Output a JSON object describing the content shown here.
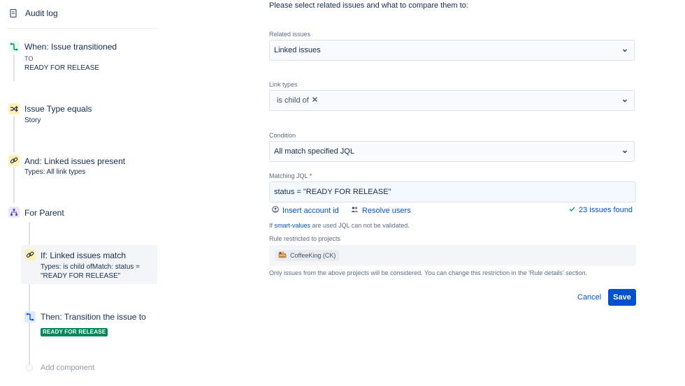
{
  "sidebar": {
    "audit_log": "Audit log",
    "steps": {
      "trigger": {
        "title": "When: Issue transitioned",
        "to_label": "TO",
        "status": "READY FOR RELEASE"
      },
      "issue_type": {
        "title": "Issue Type equals",
        "subtitle": "Story"
      },
      "linked_present": {
        "title": "And: Linked issues present",
        "subtitle": "Types: All link types"
      },
      "for_parent": {
        "title": "For Parent"
      },
      "linked_match": {
        "title": "If: Linked issues match",
        "subtitle_line1": "Types: is child ofMatch: status =",
        "subtitle_line2": "\"READY FOR RELEASE\""
      },
      "transition": {
        "title": "Then: Transition the issue to",
        "lozenge": "READY FOR RELEASE"
      },
      "add_component": "Add component"
    }
  },
  "form": {
    "intro": "Please select related issues and what to compare them to:",
    "related_issues": {
      "label": "Related issues",
      "value": "Linked issues"
    },
    "link_types": {
      "label": "Link types",
      "chip": "is child of"
    },
    "condition": {
      "label": "Condition",
      "value": "All match specified JQL"
    },
    "matching_jql": {
      "label": "Matching JQL",
      "required": "*",
      "value": "status = \"READY FOR RELEASE\""
    },
    "insert_account_id": "Insert account id",
    "resolve_users": "Resolve users",
    "issues_found": "23 issues found",
    "hint_prefix": "If ",
    "hint_link": "smart-values",
    "hint_suffix": " are used JQL can not be validated.",
    "rule_restricted": {
      "label": "Rule restricted to projects",
      "project": "CoffeeKing (CK)"
    },
    "restriction_note": "Only issues from the above projects will be considered. You can change this restriction in the 'Rule details' section.",
    "cancel": "Cancel",
    "save": "Save"
  },
  "colors": {
    "primary": "#0052cc",
    "success": "#00875a",
    "trigger_icon": "#00875a",
    "condition_icon": "#ff991f",
    "branch_icon": "#6554c0",
    "action_icon": "#0052cc"
  },
  "icons": {
    "audit": "document-icon",
    "trigger": "transition-icon",
    "issue_type": "shuffle-icon",
    "linked_present": "link-icon",
    "for_parent": "hierarchy-icon",
    "linked_match": "link-icon",
    "transition": "transition-icon"
  }
}
